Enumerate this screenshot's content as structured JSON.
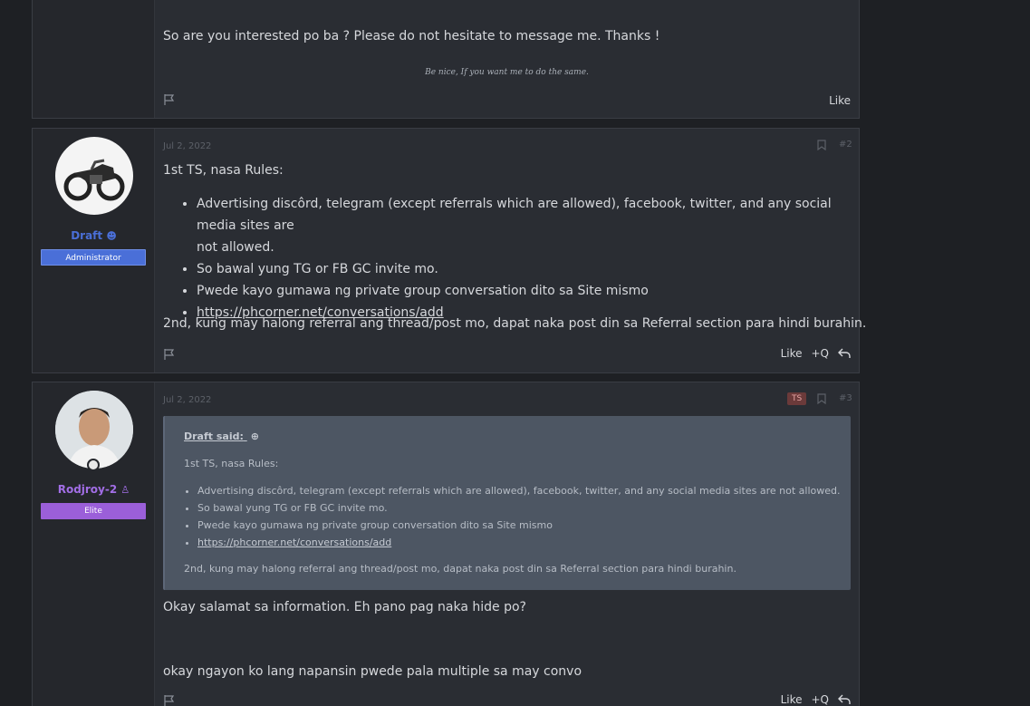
{
  "post1": {
    "body": "So are you interested po ba ? Please do not hesitate to message me. Thanks !",
    "signature": "Be nice, If you want me to do the same.",
    "like_label": "Like"
  },
  "post2": {
    "date": "Jul 2, 2022",
    "number": "#2",
    "username": "Draft",
    "role": "Administrator",
    "intro": "1st TS, nasa Rules:",
    "rules": [
      "Advertising discôrd, telegram (except referrals which are allowed), facebook, twitter, and any social media sites are",
      "not allowed.",
      "So bawal yung TG or FB GC invite mo.",
      "Pwede kayo gumawa ng private group conversation dito sa Site mismo",
      "https://phcorner.net/conversations/add"
    ],
    "outro": "2nd, kung may halong referral ang thread/post mo, dapat naka post din sa Referral section para hindi burahin.",
    "like_label": "Like",
    "quote_label": "+Q",
    "colors": {
      "username": "#4a6fd8",
      "role_badge": "#4a6fd8"
    }
  },
  "post3": {
    "date": "Jul 2, 2022",
    "number": "#3",
    "ts_badge": "TS",
    "username": "Rodjroy-2",
    "role": "Elite",
    "quote": {
      "author_label": "Draft said:",
      "intro": "1st TS, nasa Rules:",
      "rules": [
        "Advertising discôrd, telegram (except referrals which are allowed), facebook, twitter, and any social media sites are not allowed.",
        "So bawal yung TG or FB GC invite mo.",
        "Pwede kayo gumawa ng private group conversation dito sa Site mismo",
        "https://phcorner.net/conversations/add"
      ],
      "outro": "2nd, kung may halong referral ang thread/post mo, dapat naka post din sa Referral section para hindi burahin."
    },
    "reply1": "Okay salamat sa information. Eh pano pag naka hide po?",
    "reply2": "okay ngayon ko lang napansin pwede pala multiple sa may convo",
    "like_label": "Like",
    "quote_label": "+Q",
    "colors": {
      "username": "#a26ee6",
      "role_badge": "#9b5fd9"
    }
  }
}
